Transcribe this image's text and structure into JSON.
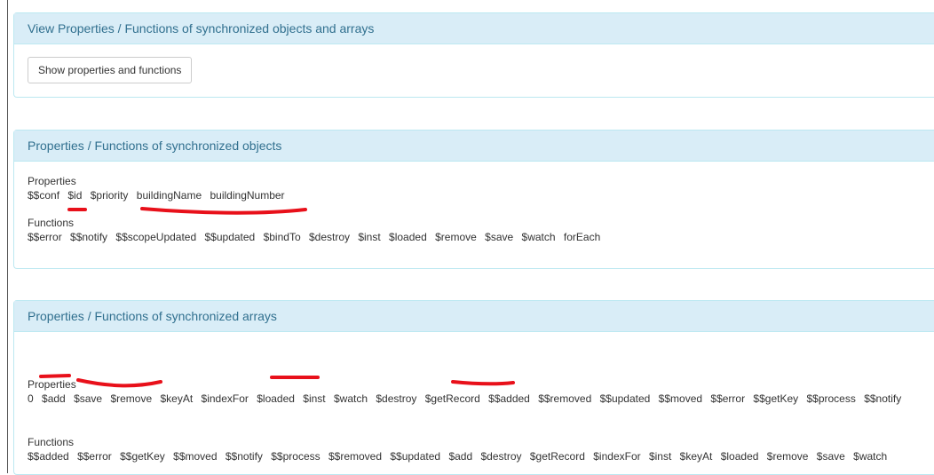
{
  "panels": {
    "view": {
      "title": "View Properties / Functions of synchronized objects and arrays",
      "button_label": "Show properties and functions"
    },
    "objects": {
      "title": "Properties / Functions of synchronized objects",
      "properties_label": "Properties",
      "properties": [
        "$$conf",
        "$id",
        "$priority",
        "buildingName",
        "buildingNumber"
      ],
      "functions_label": "Functions",
      "functions": [
        "$$error",
        "$$notify",
        "$$scopeUpdated",
        "$$updated",
        "$bindTo",
        "$destroy",
        "$inst",
        "$loaded",
        "$remove",
        "$save",
        "$watch",
        "forEach"
      ]
    },
    "arrays": {
      "title": "Properties / Functions of synchronized arrays",
      "properties_label": "Properties",
      "properties": [
        "0",
        "$add",
        "$save",
        "$remove",
        "$keyAt",
        "$indexFor",
        "$loaded",
        "$inst",
        "$watch",
        "$destroy",
        "$getRecord",
        "$$added",
        "$$removed",
        "$$updated",
        "$$moved",
        "$$error",
        "$$getKey",
        "$$process",
        "$$notify"
      ],
      "functions_label": "Functions",
      "functions": [
        "$$added",
        "$$error",
        "$$getKey",
        "$$moved",
        "$$notify",
        "$$process",
        "$$removed",
        "$$updated",
        "$add",
        "$destroy",
        "$getRecord",
        "$indexFor",
        "$inst",
        "$keyAt",
        "$loaded",
        "$remove",
        "$save",
        "$watch"
      ]
    }
  },
  "annotation_color": "#e8101a"
}
